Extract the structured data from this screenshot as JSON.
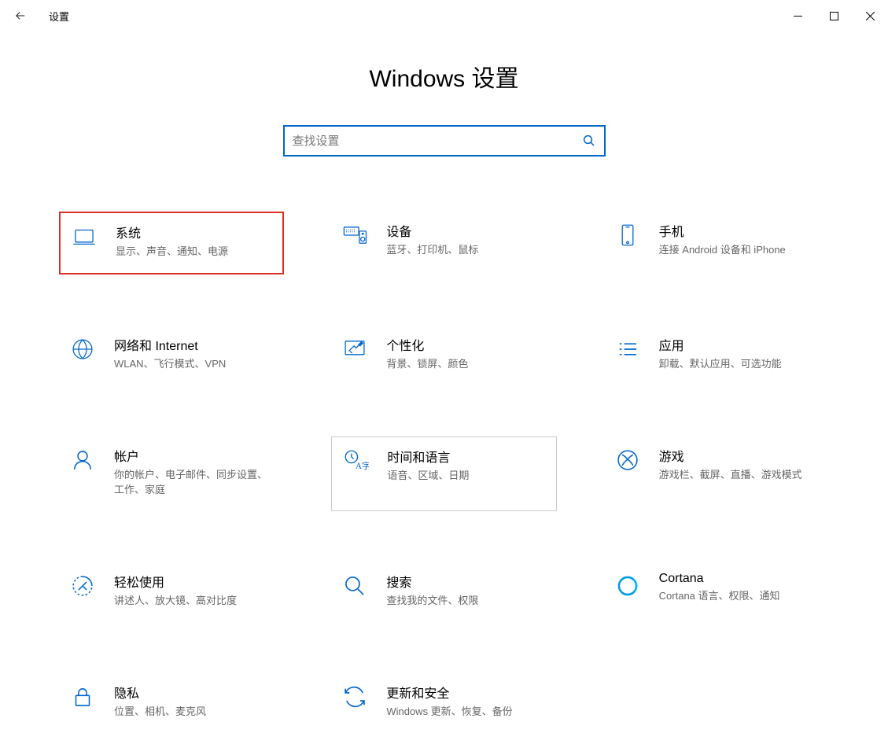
{
  "window": {
    "app_title": "设置"
  },
  "page": {
    "heading": "Windows 设置"
  },
  "search": {
    "placeholder": "查找设置"
  },
  "tiles": [
    {
      "id": "system",
      "title": "系统",
      "desc": "显示、声音、通知、电源"
    },
    {
      "id": "devices",
      "title": "设备",
      "desc": "蓝牙、打印机、鼠标"
    },
    {
      "id": "phone",
      "title": "手机",
      "desc": "连接 Android 设备和 iPhone"
    },
    {
      "id": "network",
      "title": "网络和 Internet",
      "desc": "WLAN、飞行模式、VPN"
    },
    {
      "id": "personalize",
      "title": "个性化",
      "desc": "背景、锁屏、颜色"
    },
    {
      "id": "apps",
      "title": "应用",
      "desc": "卸载、默认应用、可选功能"
    },
    {
      "id": "accounts",
      "title": "帐户",
      "desc": "你的帐户、电子邮件、同步设置、工作、家庭"
    },
    {
      "id": "time-language",
      "title": "时间和语言",
      "desc": "语音、区域、日期"
    },
    {
      "id": "gaming",
      "title": "游戏",
      "desc": "游戏栏、截屏、直播、游戏模式"
    },
    {
      "id": "ease-of-access",
      "title": "轻松使用",
      "desc": "讲述人、放大镜、高对比度"
    },
    {
      "id": "search-cat",
      "title": "搜索",
      "desc": "查找我的文件、权限"
    },
    {
      "id": "cortana",
      "title": "Cortana",
      "desc": "Cortana 语言、权限、通知"
    },
    {
      "id": "privacy",
      "title": "隐私",
      "desc": "位置、相机、麦克风"
    },
    {
      "id": "update",
      "title": "更新和安全",
      "desc": "Windows 更新、恢复、备份"
    }
  ]
}
